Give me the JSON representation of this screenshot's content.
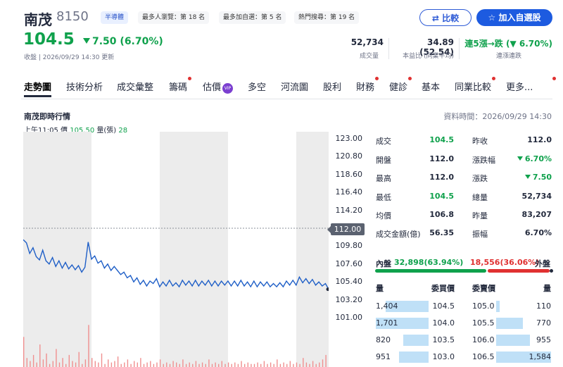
{
  "header": {
    "name": "南茂",
    "code": "8150",
    "category": "半導體",
    "tags": [
      "最多人瀏覽：第 18 名",
      "最多加自選：第 5 名",
      "熱門搜尋：第 19 名"
    ],
    "compare_label": "比較",
    "watchlist_label": "加入自選股"
  },
  "quote": {
    "price": "104.5",
    "change": "7.50 (6.70%)",
    "updated": "收盤 | 2026/09/29 14:30 更新"
  },
  "stats": [
    {
      "value": "52,734",
      "label": "成交量"
    },
    {
      "value": "34.89 (52.54)",
      "label": "本益比 (同業平均)"
    },
    {
      "value": "連5漲→跌 (▼ 6.70%)",
      "label": "連漲連跌"
    }
  ],
  "tabs": [
    {
      "label": "走勢圖",
      "active": true
    },
    {
      "label": "技術分析"
    },
    {
      "label": "成交彙整"
    },
    {
      "label": "籌碼",
      "dot": true
    },
    {
      "label": "估價",
      "vip": "VIP"
    },
    {
      "label": "多空"
    },
    {
      "label": "河流圖"
    },
    {
      "label": "股利"
    },
    {
      "label": "財務",
      "dot": true
    },
    {
      "label": "健診",
      "dot": true
    },
    {
      "label": "基本"
    },
    {
      "label": "同業比較",
      "dot": true
    },
    {
      "label": "更多...",
      "dot": true
    }
  ],
  "section": {
    "title": "南茂即時行情",
    "data_time": "資料時間：2026/09/29 14:30",
    "rt_time": "上午11:05",
    "rt_price_label": "價",
    "rt_price": "105.50",
    "rt_volume_label": "量(張)",
    "rt_volume": "28"
  },
  "chart_data": {
    "type": "line",
    "yticks": [
      "123.00",
      "120.80",
      "118.60",
      "116.40",
      "114.20",
      "112.00",
      "109.80",
      "107.60",
      "105.40",
      "103.20",
      "101.00"
    ],
    "ylim": [
      101.0,
      123.0
    ],
    "reference": "112.00",
    "reference_value": 112.0,
    "price_series": [
      110.6,
      110.2,
      108.9,
      109.6,
      108.5,
      108.1,
      109.3,
      108.0,
      107.6,
      108.4,
      107.3,
      108.0,
      107.1,
      107.8,
      107.0,
      107.5,
      106.9,
      107.4,
      106.6,
      107.2,
      110.3,
      108.2,
      108.6,
      107.7,
      108.0,
      107.1,
      107.6,
      106.8,
      107.3,
      106.8,
      106.3,
      106.6,
      105.9,
      106.2,
      105.4,
      105.9,
      105.1,
      105.6,
      104.9,
      105.5,
      105.2,
      105.8,
      104.8,
      105.4,
      104.9,
      105.6,
      104.9,
      105.3,
      104.8,
      105.6,
      105.0,
      105.5,
      104.9,
      105.6,
      104.9,
      105.5,
      105.0,
      105.6,
      104.9,
      105.5,
      104.9,
      105.5,
      105.0,
      105.5,
      104.9,
      105.5,
      104.9,
      105.6,
      104.9,
      105.4,
      104.8,
      105.5,
      104.8,
      105.4,
      104.9,
      105.4,
      104.8,
      105.2,
      104.8,
      105.3,
      104.8,
      105.5,
      105.0,
      105.6,
      105.0,
      106.0,
      105.3,
      105.8,
      105.2,
      105.7,
      105.0,
      105.4,
      104.9,
      105.2,
      104.5
    ],
    "volume_series": [
      20,
      6,
      4,
      8,
      3,
      15,
      5,
      9,
      2,
      4,
      12,
      3,
      6,
      2,
      8,
      4,
      3,
      10,
      2,
      5,
      28,
      6,
      4,
      3,
      9,
      2,
      5,
      3,
      4,
      7,
      2,
      3,
      5,
      2,
      4,
      3,
      6,
      2,
      3,
      4,
      2,
      3,
      5,
      2,
      3,
      2,
      4,
      3,
      2,
      5,
      2,
      3,
      2,
      4,
      2,
      3,
      2,
      5,
      2,
      3,
      2,
      4,
      2,
      3,
      2,
      3,
      2,
      4,
      2,
      3,
      2,
      2,
      3,
      2,
      4,
      2,
      3,
      2,
      5,
      2,
      3,
      2,
      4,
      2,
      3,
      2,
      6,
      3,
      2,
      4,
      2,
      3,
      5,
      8,
      30
    ]
  },
  "quote_table": {
    "left": [
      {
        "label": "成交",
        "value": "104.5",
        "color": "green"
      },
      {
        "label": "開盤",
        "value": "112.0",
        "color": "black"
      },
      {
        "label": "最高",
        "value": "112.0",
        "color": "black"
      },
      {
        "label": "最低",
        "value": "104.5",
        "color": "green"
      },
      {
        "label": "均價",
        "value": "106.8",
        "color": "black"
      },
      {
        "label": "成交金額(億)",
        "value": "56.35",
        "color": "black"
      }
    ],
    "right": [
      {
        "label": "昨收",
        "value": "112.0",
        "color": "black"
      },
      {
        "label": "漲跌幅",
        "value": "6.70%",
        "color": "green",
        "arrow": true
      },
      {
        "label": "漲跌",
        "value": "7.50",
        "color": "green",
        "arrow": true
      },
      {
        "label": "總量",
        "value": "52,734",
        "color": "black"
      },
      {
        "label": "昨量",
        "value": "83,207",
        "color": "black"
      },
      {
        "label": "振幅",
        "value": "6.70%",
        "color": "black"
      }
    ]
  },
  "inner_outer": {
    "inner_label": "內盤",
    "inner_value": "32,898(63.94%)",
    "inner_pct": 63.94,
    "outer_value": "18,556(36.06%)",
    "outer_label": "外盤",
    "outer_pct": 36.06
  },
  "order_book": {
    "headers": [
      "量",
      "委買價",
      "委賣價",
      "量"
    ],
    "rows": [
      {
        "bid_qty": "1,404",
        "bid_price": "104.5",
        "ask_price": "105.0",
        "ask_qty": "110",
        "bid_fill": 0.82,
        "ask_fill": 0.06
      },
      {
        "bid_qty": "1,701",
        "bid_price": "104.0",
        "ask_price": "105.5",
        "ask_qty": "770",
        "bid_fill": 1.0,
        "ask_fill": 0.49
      },
      {
        "bid_qty": "820",
        "bid_price": "103.5",
        "ask_price": "106.0",
        "ask_qty": "955",
        "bid_fill": 0.48,
        "ask_fill": 0.61
      },
      {
        "bid_qty": "951",
        "bid_price": "103.0",
        "ask_price": "106.5",
        "ask_qty": "1,584",
        "bid_fill": 0.56,
        "ask_fill": 1.0
      }
    ]
  },
  "colors": {
    "up": "#e03131",
    "down": "#0fa14c",
    "line": "#1f5fc7",
    "accent": "#1d5be0"
  }
}
